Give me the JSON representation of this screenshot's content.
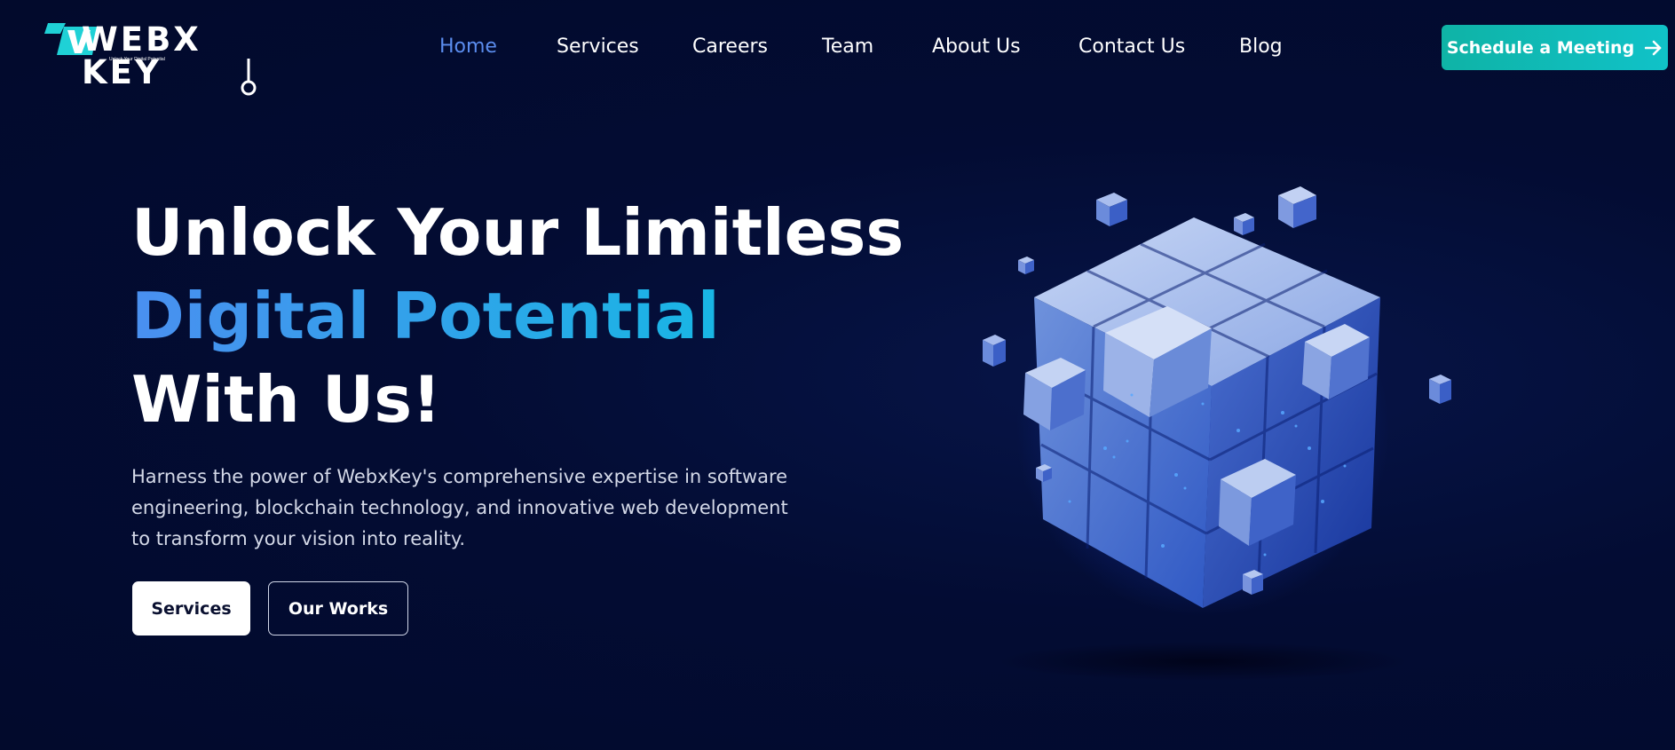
{
  "brand": {
    "name": "WEBX KEY",
    "tagline": "Unlock Your Digital Potential",
    "accent": "#1fd1d6"
  },
  "nav": {
    "items": [
      {
        "label": "Home",
        "active": true
      },
      {
        "label": "Services",
        "active": false
      },
      {
        "label": "Careers",
        "active": false
      },
      {
        "label": "Team",
        "active": false
      },
      {
        "label": "About Us",
        "active": false
      },
      {
        "label": "Contact Us",
        "active": false
      },
      {
        "label": "Blog",
        "active": false
      }
    ],
    "active_color": "#5b8def"
  },
  "cta": {
    "label": "Schedule a Meeting",
    "icon": "arrow-right-icon",
    "color": "#10bcb8"
  },
  "hero": {
    "title_line1": "Unlock Your Limitless",
    "title_line2": "Digital Potential",
    "title_line3": "With Us!",
    "description": "Harness the power of WebxKey's comprehensive expertise in software engineering, blockchain technology, and innovative web development to transform your vision into reality.",
    "primary_button": "Services",
    "secondary_button": "Our Works"
  },
  "illustration": {
    "name": "blue-data-cube",
    "colors": [
      "#2a5fd8",
      "#9fb8ea",
      "#0c2a9c"
    ]
  }
}
